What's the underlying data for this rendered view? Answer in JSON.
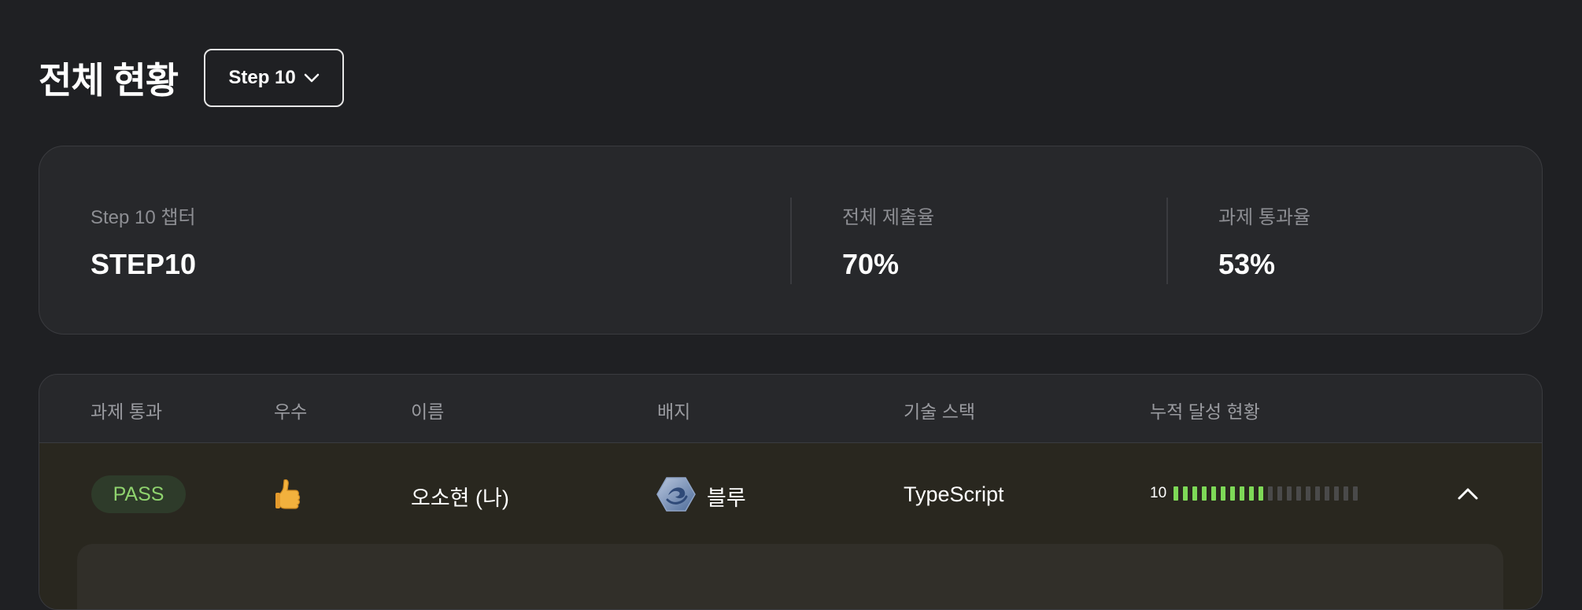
{
  "header": {
    "title": "전체 현황",
    "step_select_value": "Step 10"
  },
  "summary": {
    "chapter_label": "Step 10 챕터",
    "chapter_value": "STEP10",
    "submission_label": "전체 제출율",
    "submission_value": "70%",
    "pass_label": "과제 통과율",
    "pass_value": "53%"
  },
  "table": {
    "headers": [
      "과제 통과",
      "우수",
      "이름",
      "배지",
      "기술 스택",
      "누적 달성 현황"
    ],
    "rows": [
      {
        "status": "PASS",
        "excellent_icon": "thumbs-up-icon",
        "name": "오소현 (나)",
        "badge_icon": "blue-badge-icon",
        "badge_label": "블루",
        "tech_stack": "TypeScript",
        "progress_count": "10",
        "progress_completed": 10,
        "progress_total": 20
      }
    ]
  },
  "colors": {
    "background": "#1f2023",
    "card": "#27282b",
    "pass_text": "#8fd36e",
    "pass_bg": "#2e3b2a",
    "progress_on": "#7ed957",
    "progress_off": "#4a4a4a"
  }
}
